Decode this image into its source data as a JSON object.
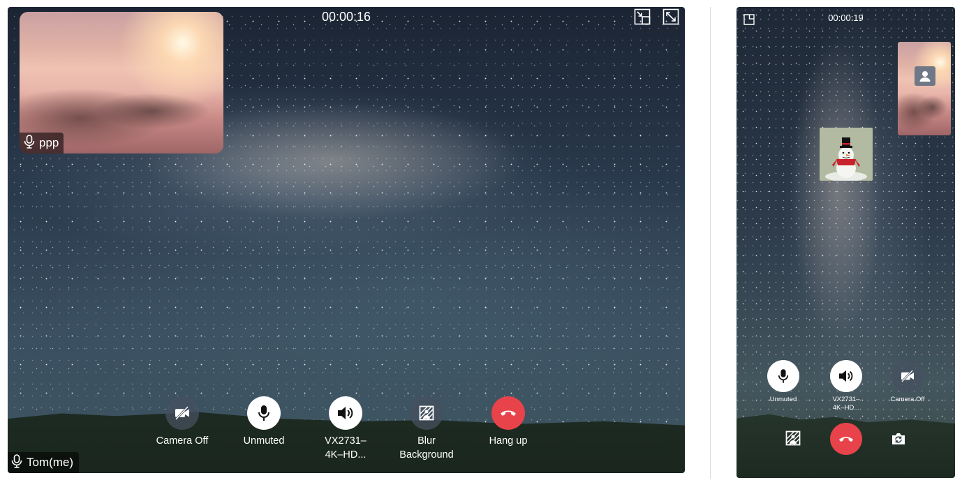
{
  "desktop": {
    "timer": "00:00:16",
    "pip_name": "ppp",
    "self_name": "Tom(me)",
    "controls": [
      {
        "label": "Camera Off",
        "icon": "camera-off-icon"
      },
      {
        "label": "Unmuted",
        "icon": "microphone-icon"
      },
      {
        "label": "VX2731–\n4K–HD...",
        "icon": "speaker-icon"
      },
      {
        "label": "Blur\nBackground",
        "icon": "blur-background-icon"
      },
      {
        "label": "Hang up",
        "icon": "hang-up-icon"
      }
    ],
    "top_icons": [
      "minimize-icon",
      "fullscreen-icon"
    ]
  },
  "mobile": {
    "timer": "00:00:19",
    "controls": [
      {
        "label": "Unmuted",
        "icon": "microphone-icon"
      },
      {
        "label": "VX2731–\n4K–HD...",
        "icon": "speaker-icon"
      },
      {
        "label": "Camera Off",
        "icon": "camera-off-icon"
      }
    ],
    "bottom_icons": [
      "blur-background-icon",
      "hang-up-icon",
      "switch-camera-icon"
    ],
    "top_icon": "floating-window-icon"
  },
  "colors": {
    "hangup_red": "#e8434a",
    "button_white": "#ffffff",
    "button_dark": "#46505f"
  }
}
